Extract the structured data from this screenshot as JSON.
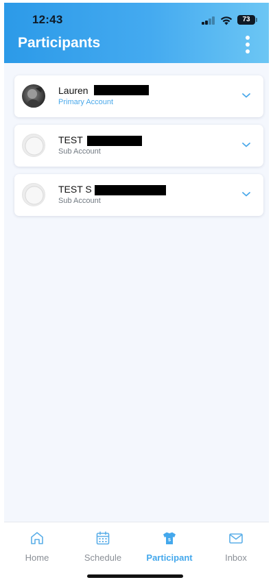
{
  "status_bar": {
    "time": "12:43",
    "battery": "73",
    "icons": [
      "signal-icon",
      "wifi-icon",
      "battery-icon"
    ]
  },
  "header": {
    "title": "Participants",
    "menu_icon": "more-vertical-icon"
  },
  "participants": [
    {
      "first_name": "Lauren",
      "role": "Primary Account",
      "avatar": "photo"
    },
    {
      "first_name": "TEST",
      "role": "Sub Account",
      "avatar": "placeholder"
    },
    {
      "first_name": "TEST S",
      "role": "Sub Account",
      "avatar": "placeholder"
    }
  ],
  "tab_bar": {
    "items": [
      {
        "label": "Home",
        "icon": "home-icon"
      },
      {
        "label": "Schedule",
        "icon": "calendar-icon"
      },
      {
        "label": "Participant",
        "icon": "jersey-icon",
        "active": true
      },
      {
        "label": "Inbox",
        "icon": "envelope-icon"
      }
    ]
  },
  "colors": {
    "accent": "#44a8ec",
    "header_start": "#2c9ae8",
    "header_end": "#6cc6f4",
    "background": "#f4f7fd",
    "primary_account": "#49a8ea"
  }
}
